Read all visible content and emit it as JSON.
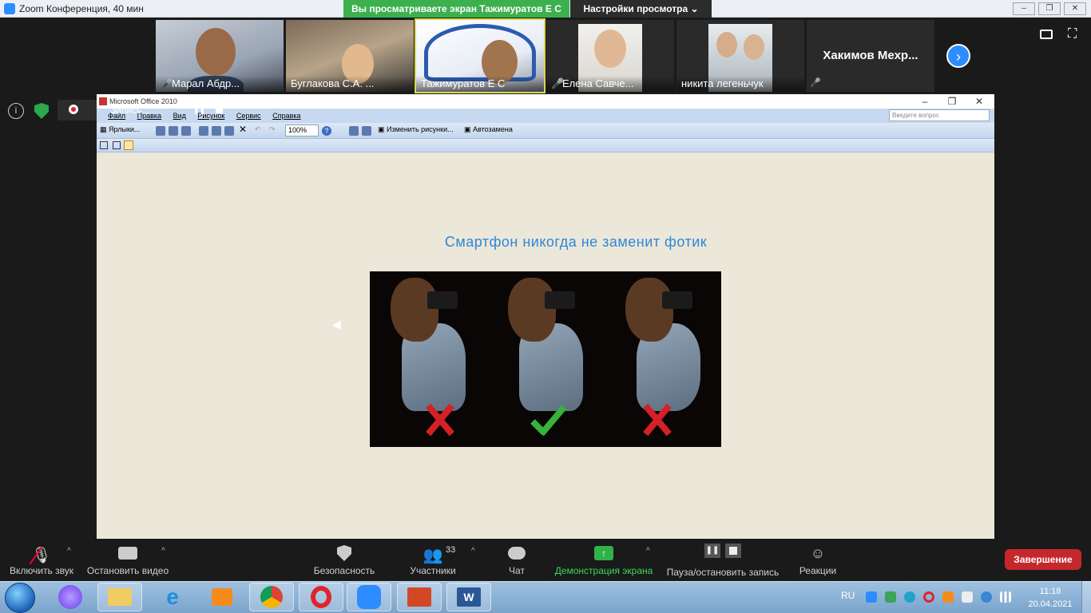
{
  "zoom": {
    "window_title": "Zoom Конференция, 40 мин",
    "share_banner": "Вы просматриваете экран Тажимуратов Е С",
    "view_settings": "Настройки просмотра",
    "recording_label": "Запись...",
    "participants": [
      {
        "name": "Марал Абдр...",
        "muted": true
      },
      {
        "name": "Буглакова С.А. ...",
        "muted": false
      },
      {
        "name": "Тажимуратов Е С",
        "muted": false,
        "active": true
      },
      {
        "name": "Елена Савче...",
        "muted": true
      },
      {
        "name": "никита легеньчук",
        "muted": false
      },
      {
        "name": "Хакимов Мехр...",
        "muted": true
      }
    ],
    "bottom_bar": {
      "unmute": "Включить звук",
      "stop_video": "Остановить видео",
      "security": "Безопасность",
      "participants": "Участники",
      "participants_count": "33",
      "chat": "Чат",
      "share_screen": "Демонстрация экрана",
      "pause_recording": "Пауза/остановить запись",
      "reactions": "Реакции",
      "end": "Завершение"
    }
  },
  "office": {
    "title": "Microsoft Office 2010",
    "menu": [
      "Файл",
      "Правка",
      "Вид",
      "Рисунок",
      "Сервис",
      "Справка"
    ],
    "search_placeholder": "Введите вопрос",
    "toolbar": {
      "shortcuts": "Ярлыки...",
      "zoom": "100%",
      "edit_pictures": "Изменить рисунки...",
      "autocorrect": "Автозамена"
    },
    "slide_title": "Смартфон никогда не заменит фотик"
  },
  "taskbar": {
    "language": "RU",
    "time": "11:18",
    "date": "20.04.2021"
  }
}
